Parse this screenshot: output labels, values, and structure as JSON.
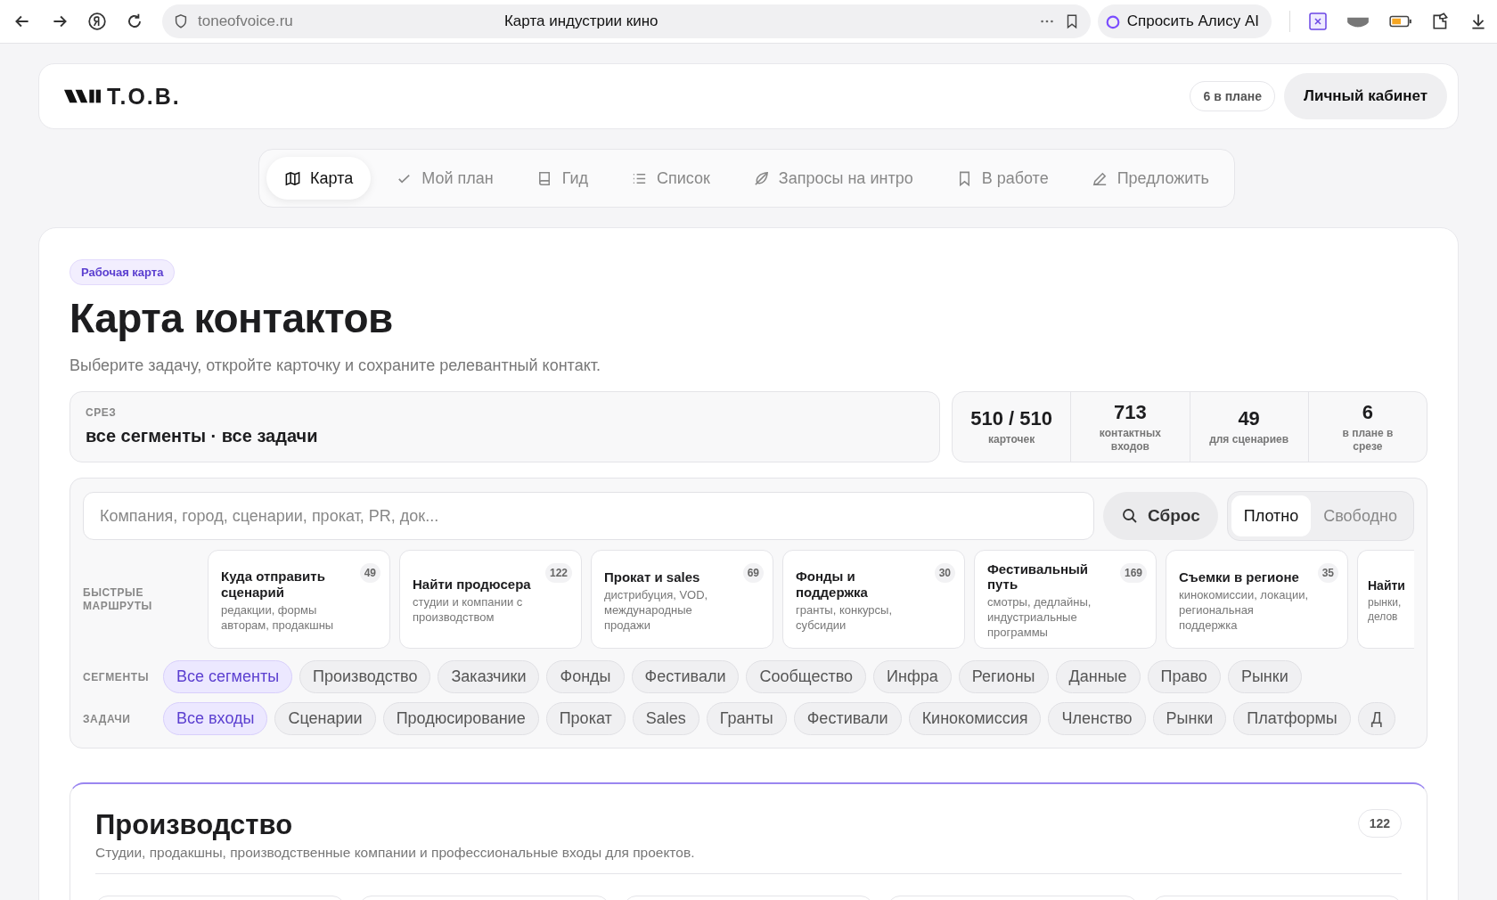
{
  "browser": {
    "url": "toneofvoice.ru",
    "page_title": "Карта индустрии кино",
    "assistant_button": "Спросить Алису AI"
  },
  "header": {
    "logo": "Т.О.В.",
    "plan_badge": "6 в плане",
    "account_button": "Личный кабинет"
  },
  "nav": [
    {
      "label": "Карта",
      "selected": true
    },
    {
      "label": "Мой план",
      "selected": false
    },
    {
      "label": "Гид",
      "selected": false
    },
    {
      "label": "Список",
      "selected": false
    },
    {
      "label": "Запросы на интро",
      "selected": false
    },
    {
      "label": "В работе",
      "selected": false
    },
    {
      "label": "Предложить",
      "selected": false
    }
  ],
  "hero": {
    "badge": "Рабочая карта",
    "title": "Карта контактов",
    "subtitle": "Выберите задачу, откройте карточку и сохраните релевантный контакт."
  },
  "slice": {
    "label": "СРЕЗ",
    "value": "все сегменты · все задачи"
  },
  "stats": [
    {
      "value": "510 / 510",
      "label": "карточек"
    },
    {
      "value": "713",
      "label": "контактных входов"
    },
    {
      "value": "49",
      "label": "для сценариев"
    },
    {
      "value": "6",
      "label": "в плане в срезе"
    }
  ],
  "search": {
    "placeholder": "Компания, город, сценарии, прокат, PR, док...",
    "reset_button": "Сброс"
  },
  "density": [
    {
      "label": "Плотно",
      "selected": true
    },
    {
      "label": "Свободно",
      "selected": false
    }
  ],
  "routes_label": "БЫСТРЫЕ МАРШРУТЫ",
  "routes": [
    {
      "title": "Куда отправить сценарий",
      "description": "редакции, формы авторам, продакшны",
      "count": "49"
    },
    {
      "title": "Найти продюсера",
      "description": "студии и компании с производством",
      "count": "122"
    },
    {
      "title": "Прокат и sales",
      "description": "дистрибуция, VOD, международные продажи",
      "count": "69"
    },
    {
      "title": "Фонды и поддержка",
      "description": "гранты, конкурсы, субсидии",
      "count": "30"
    },
    {
      "title": "Фестивальный путь",
      "description": "смотры, дедлайны, индустриальные программы",
      "count": "169"
    },
    {
      "title": "Съемки в регионе",
      "description": "кинокомиссии, локации, региональная поддержка",
      "count": "35"
    },
    {
      "title": "Найти",
      "description": "рынки, делов"
    }
  ],
  "segments_label": "СЕГМЕНТЫ",
  "segments": [
    {
      "label": "Все сегменты",
      "selected": true
    },
    {
      "label": "Производство",
      "selected": false
    },
    {
      "label": "Заказчики",
      "selected": false
    },
    {
      "label": "Фонды",
      "selected": false
    },
    {
      "label": "Фестивали",
      "selected": false
    },
    {
      "label": "Сообщество",
      "selected": false
    },
    {
      "label": "Инфра",
      "selected": false
    },
    {
      "label": "Регионы",
      "selected": false
    },
    {
      "label": "Данные",
      "selected": false
    },
    {
      "label": "Право",
      "selected": false
    },
    {
      "label": "Рынки",
      "selected": false
    }
  ],
  "tasks_label": "ЗАДАЧИ",
  "tasks": [
    {
      "label": "Все входы",
      "selected": true
    },
    {
      "label": "Сценарии",
      "selected": false
    },
    {
      "label": "Продюсирование",
      "selected": false
    },
    {
      "label": "Прокат",
      "selected": false
    },
    {
      "label": "Sales",
      "selected": false
    },
    {
      "label": "Гранты",
      "selected": false
    },
    {
      "label": "Фестивали",
      "selected": false
    },
    {
      "label": "Кинокомиссия",
      "selected": false
    },
    {
      "label": "Членство",
      "selected": false
    },
    {
      "label": "Рынки",
      "selected": false
    },
    {
      "label": "Платформы",
      "selected": false
    },
    {
      "label": "Д",
      "selected": false
    }
  ],
  "section": {
    "title": "Производство",
    "description": "Студии, продакшны, производственные компании и профессиональные входы для проектов.",
    "count": "122"
  }
}
